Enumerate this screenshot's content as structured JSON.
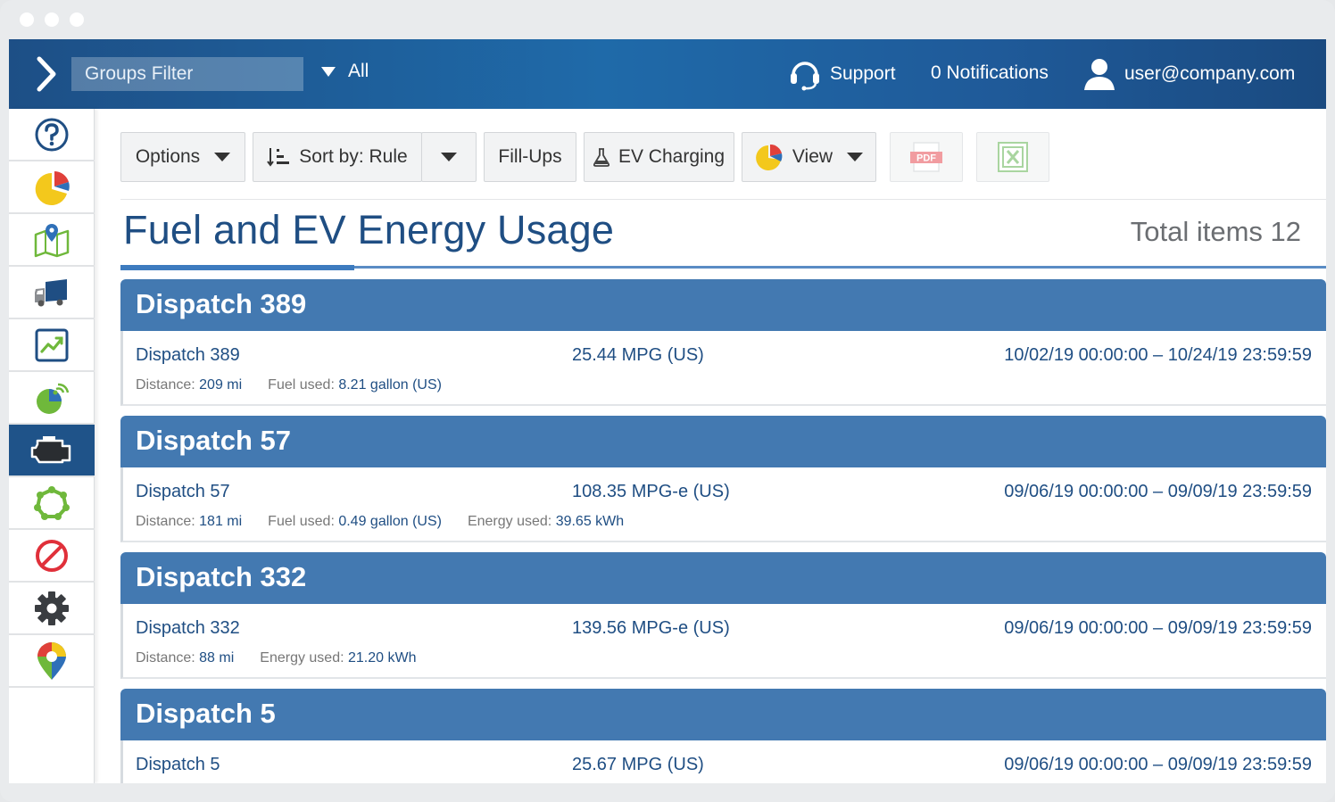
{
  "header": {
    "groups_filter_placeholder": "Groups Filter",
    "all_label": "All",
    "support_label": "Support",
    "notifications_label": "0 Notifications",
    "user_label": "user@company.com"
  },
  "sidebar": {
    "items": [
      {
        "icon": "help-icon"
      },
      {
        "icon": "dashboard-pie-icon"
      },
      {
        "icon": "map-icon"
      },
      {
        "icon": "vehicles-truck-icon"
      },
      {
        "icon": "activity-chart-icon"
      },
      {
        "icon": "engine-data-icon"
      },
      {
        "icon": "fuel-engine-icon",
        "active": true
      },
      {
        "icon": "zones-icon"
      },
      {
        "icon": "rules-exceptions-icon"
      },
      {
        "icon": "settings-gear-icon"
      },
      {
        "icon": "marketplace-pin-icon"
      }
    ]
  },
  "toolbar": {
    "options_label": "Options",
    "sort_label": "Sort by: Rule",
    "fillups_label": "Fill-Ups",
    "ev_label": "EV Charging",
    "view_label": "View",
    "pdf_label": "PDF"
  },
  "page": {
    "title": "Fuel and EV Energy Usage",
    "total": "Total items 12"
  },
  "groups": [
    {
      "header": "Dispatch 389",
      "name": "Dispatch 389",
      "mpg": "25.44 MPG (US)",
      "date": "10/02/19 00:00:00 – 10/24/19 23:59:59",
      "details": [
        {
          "label": "Distance: ",
          "value": "209 mi"
        },
        {
          "label": "Fuel used: ",
          "value": "8.21 gallon (US)"
        }
      ]
    },
    {
      "header": "Dispatch 57",
      "name": "Dispatch 57",
      "mpg": "108.35 MPG-e (US)",
      "date": "09/06/19 00:00:00 – 09/09/19 23:59:59",
      "details": [
        {
          "label": "Distance: ",
          "value": "181 mi"
        },
        {
          "label": "Fuel used: ",
          "value": "0.49 gallon (US)"
        },
        {
          "label": "Energy used: ",
          "value": "39.65 kWh"
        }
      ]
    },
    {
      "header": "Dispatch 332",
      "name": "Dispatch 332",
      "mpg": "139.56 MPG-e (US)",
      "date": "09/06/19 00:00:00 – 09/09/19 23:59:59",
      "details": [
        {
          "label": "Distance: ",
          "value": "88 mi"
        },
        {
          "label": "Energy used: ",
          "value": "21.20 kWh"
        }
      ]
    },
    {
      "header": "Dispatch 5",
      "name": "Dispatch 5",
      "mpg": "25.67 MPG (US)",
      "date": "09/06/19 00:00:00 – 09/09/19 23:59:59",
      "details": []
    }
  ],
  "colors": {
    "brand": "#1f5389",
    "group_header": "#4379b1",
    "text_link": "#1f4e83"
  }
}
